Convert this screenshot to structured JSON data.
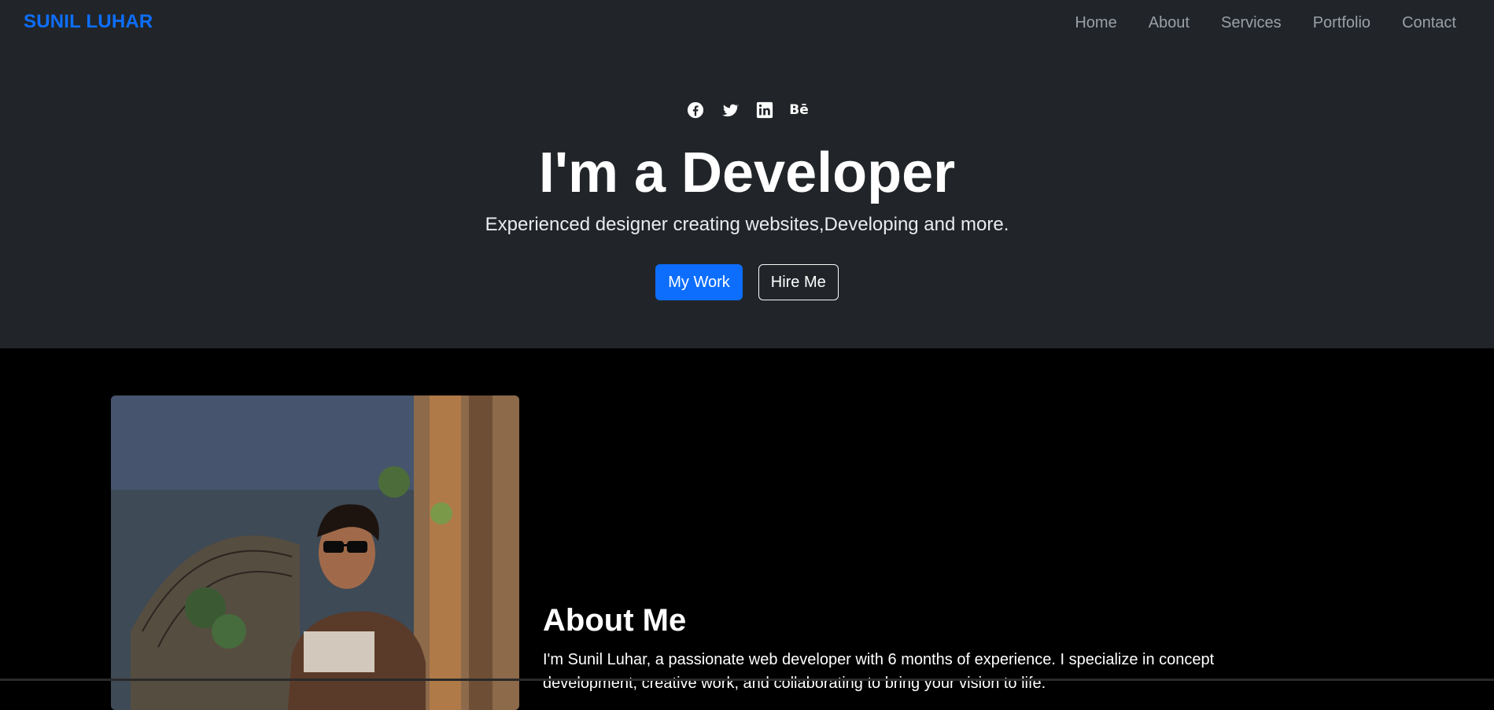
{
  "navbar": {
    "brand": "SUNIL LUHAR",
    "links": [
      "Home",
      "About",
      "Services",
      "Portfolio",
      "Contact"
    ]
  },
  "hero": {
    "social_icons": [
      "facebook-icon",
      "twitter-icon",
      "linkedin-icon",
      "behance-icon"
    ],
    "behance_label": "Bē",
    "title": "I'm a Developer",
    "subtitle": "Experienced designer creating websites,Developing and more.",
    "primary_button": "My Work",
    "secondary_button": "Hire Me"
  },
  "about": {
    "title": "About Me",
    "text": "I'm Sunil Luhar, a passionate web developer with 6 months of experience. I specialize in concept development, creative work, and collaborating to bring your vision to life."
  },
  "colors": {
    "brand": "#0d6efd",
    "header_bg": "#212529",
    "section_bg": "#000000"
  }
}
